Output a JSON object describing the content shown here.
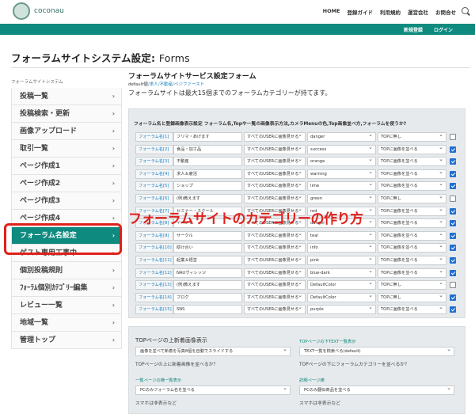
{
  "header": {
    "logo_text": "coconau",
    "nav": [
      "HOME",
      "登録ガイド",
      "利用規約",
      "運営会社",
      "お問合せ"
    ],
    "sub_links": [
      "新規登録",
      "ログイン"
    ]
  },
  "page_title": "フォーラムサイトシステム設定:",
  "page_title_sub": "Forms",
  "sidebar": {
    "heading": "フォーラムサイトシステム",
    "items": [
      {
        "label": "投稿一覧"
      },
      {
        "label": "投稿検索・更新"
      },
      {
        "label": "画像アップロード"
      },
      {
        "label": "取引一覧"
      },
      {
        "label": "ページ作成1"
      },
      {
        "label": "ページ作成2"
      },
      {
        "label": "ページ作成3"
      },
      {
        "label": "ページ作成4"
      },
      {
        "label": "フォーラム名設定"
      },
      {
        "label": "ゲスト専用工事中"
      },
      {
        "label": "個別投稿規則"
      },
      {
        "label": "ﾌｫｰﾗﾑ個別ｶﾃｺﾞﾘｰ編集"
      },
      {
        "label": "レビュー一覧"
      },
      {
        "label": "地域一覧"
      },
      {
        "label": "管理トップ"
      }
    ]
  },
  "main": {
    "title": "フォーラムサイトサービス設定フォーム",
    "defaults_prefix": "default値",
    "defaults_links": "/求人/不動産/ペジファースト",
    "note": "フォーラムサイトは最大15個までのフォーラムカテゴリーが持てます。",
    "panel_heading": "フォーラム名と登録画像表示設定 フォーラム名,Topや一覧の画像表示方法,カメラMenuの色,Top画像並べ方,フォーラムを使うか?",
    "rows": [
      {
        "label": "フォーラム名[1]",
        "name": "フリマ・あげます",
        "display": "すべてのUSERに画像見せる",
        "color": "danger",
        "top": "TOPに無し",
        "use": false
      },
      {
        "label": "フォーラム名[2]",
        "name": "食品・加工品",
        "display": "すべてのUSERに画像見せる",
        "color": "success",
        "top": "TOPに画像を並べる",
        "use": true
      },
      {
        "label": "フォーラム名[3]",
        "name": "不動産",
        "display": "すべてのUSERに画像見せる",
        "color": "orange",
        "top": "TOPに画像を並べる",
        "use": true
      },
      {
        "label": "フォーラム名[4]",
        "name": "求人＆雇活",
        "display": "すべてのUSERに画像見せる",
        "color": "warning",
        "top": "TOPに画像を並べる",
        "use": true
      },
      {
        "label": "フォーラム名[5]",
        "name": "ショップ",
        "display": "すべてのUSERに画像見せる",
        "color": "lime",
        "top": "TOPに画像を並べる",
        "use": true
      },
      {
        "label": "フォーラム名[6]",
        "name": "(例)教えます",
        "display": "すべてのUSERに画像見せる",
        "color": "green",
        "top": "TOPに無し",
        "use": false
      },
      {
        "label": "フォーラム名[7]",
        "name": "セミナー・スクール",
        "display": "すべてのUSERに画像見せる",
        "color": "red",
        "top": "TOPに画像を並べる",
        "use": true
      },
      {
        "label": "フォーラム名[8]",
        "name": "イベント",
        "display": "すべてのUSERに画像見せる",
        "color": "danger",
        "top": "TOPに画像を並べる",
        "use": true
      },
      {
        "label": "フォーラム名[9]",
        "name": "サークル",
        "display": "すべてのUSERに画像見せる",
        "color": "teal",
        "top": "TOPに画像を並べる",
        "use": true
      },
      {
        "label": "フォーラム名[10]",
        "name": "助け合い",
        "display": "すべてのUSERに画像見せる",
        "color": "info",
        "top": "TOPに画像を並べる",
        "use": true
      },
      {
        "label": "フォーラム名[11]",
        "name": "起業＆経営",
        "display": "すべてのUSERに画像見せる",
        "color": "pink",
        "top": "TOPに画像を並べる",
        "use": true
      },
      {
        "label": "フォーラム名[12]",
        "name": "NAUヴィレッジ",
        "display": "すべてのUSERに画像見せる",
        "color": "blue-dark",
        "top": "TOPに画像を並べる",
        "use": true
      },
      {
        "label": "フォーラム名[13]",
        "name": "(例)教えます",
        "display": "すべてのUSERに画像見せる",
        "color": "DefaultColor",
        "top": "TOPに無し",
        "use": false
      },
      {
        "label": "フォーラム名[14]",
        "name": "ブログ",
        "display": "すべてのUSERに画像見せる",
        "color": "DefaultColor",
        "top": "TOPに無し",
        "use": true
      },
      {
        "label": "フォーラム名[15]",
        "name": "SNS",
        "display": "すべてのUSERに画像見せる",
        "color": "purple",
        "top": "TOPに画像を並べる",
        "use": true
      }
    ]
  },
  "overlay": "フォーラムサイトのカテゴリーの作り方",
  "bottom": {
    "top_image_title": "TOPページの上新着画像表示",
    "top_image_select": "画像を並べて新着を写真8個を自動でスライドする",
    "top_image_help": "TOPページの上に新着画像を並べるか？",
    "top_text_label": "TOPページの下TEXT一覧表示",
    "top_text_select": "TEXT一覧を検索べる(default)",
    "top_text_help": "TOPページの下にフォーラムカテゴリーを並べるか？",
    "list_label": "一覧ページの横一覧表示",
    "list_select": "PCのみフォーラム名を並べる",
    "list_help": "スマホは非表示など",
    "detail_label": "詳細ページ横",
    "detail_select": "PCのみ翻似商品を並べる",
    "detail_help": "スマホは非表示など"
  }
}
